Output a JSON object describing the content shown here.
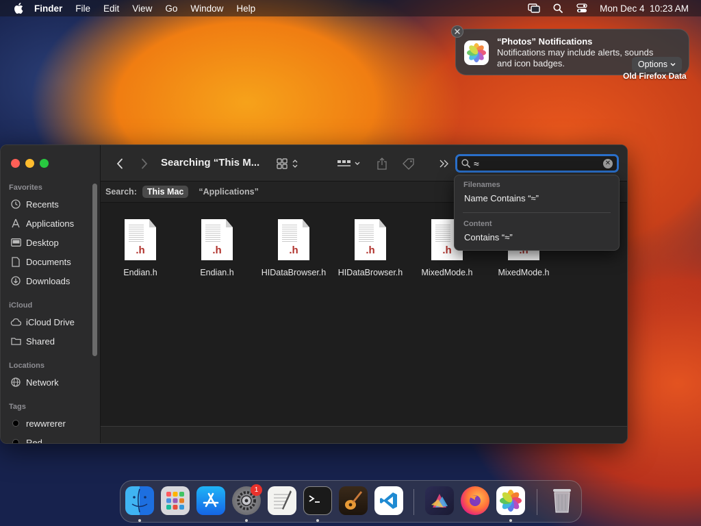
{
  "menubar": {
    "items": [
      "Finder",
      "File",
      "Edit",
      "View",
      "Go",
      "Window",
      "Help"
    ],
    "clock": "Mon Dec 4  10:23 AM"
  },
  "notification": {
    "title": "“Photos” Notifications",
    "body": "Notifications may include alerts, sounds and icon badges.",
    "options_label": "Options"
  },
  "desktop": {
    "label": "Old Firefox Data"
  },
  "finder": {
    "title": "Searching “This M...",
    "sidebar": {
      "favorites_head": "Favorites",
      "favorites": [
        "Recents",
        "Applications",
        "Desktop",
        "Documents",
        "Downloads"
      ],
      "icloud_head": "iCloud",
      "icloud": [
        "iCloud Drive",
        "Shared"
      ],
      "locations_head": "Locations",
      "locations": [
        "Network"
      ],
      "tags_head": "Tags",
      "tags": [
        "rewwrerer",
        "Red"
      ]
    },
    "search": {
      "value": "≈"
    },
    "scope": {
      "label": "Search:",
      "active": "This Mac",
      "other": "“Applications”"
    },
    "files": [
      {
        "name": "Endian.h",
        "ext": ".h"
      },
      {
        "name": "Endian.h",
        "ext": ".h"
      },
      {
        "name": "HIDataBrowser.h",
        "ext": ".h"
      },
      {
        "name": "HIDataBrowser.h",
        "ext": ".h"
      },
      {
        "name": "MixedMode.h",
        "ext": ".h"
      },
      {
        "name": "MixedMode.h",
        "ext": ".h"
      }
    ],
    "suggestions": {
      "filenames_head": "Filenames",
      "filenames_item": "Name Contains “≈”",
      "content_head": "Content",
      "content_item": "Contains “≈”"
    }
  },
  "dock": {
    "apps": [
      "finder",
      "launchpad",
      "app-store",
      "system-settings",
      "textedit",
      "terminal",
      "garageband",
      "vscode",
      "affinity",
      "firefox",
      "photos"
    ],
    "settings_badge": "1"
  },
  "colors": {
    "accent": "#2a6fc9",
    "close_red": "#ff5f57",
    "minimize_yellow": "#febc2e",
    "zoom_green": "#28c840"
  }
}
